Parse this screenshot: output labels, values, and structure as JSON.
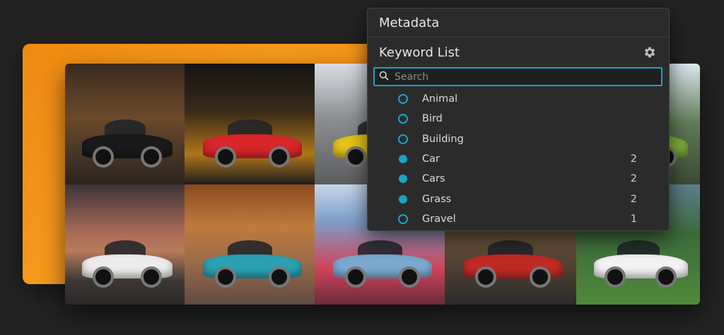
{
  "panel": {
    "title": "Metadata",
    "section_title": "Keyword List",
    "search_placeholder": "Search",
    "accent_color": "#1aa3c6"
  },
  "keywords": [
    {
      "label": "Animal",
      "count": "",
      "checked": false
    },
    {
      "label": "Bird",
      "count": "",
      "checked": false
    },
    {
      "label": "Building",
      "count": "",
      "checked": false
    },
    {
      "label": "Car",
      "count": "2",
      "checked": true
    },
    {
      "label": "Cars",
      "count": "2",
      "checked": true
    },
    {
      "label": "Grass",
      "count": "2",
      "checked": true
    },
    {
      "label": "Gravel",
      "count": "1",
      "checked": false
    }
  ],
  "photos": [
    {
      "name": "black-classic-porsche",
      "bg": "linear-gradient(180deg,#3b2a1e 0%,#6b4a2c 45%,#2a241e 100%)",
      "car": "#1a1a1a"
    },
    {
      "name": "red-porsche-gt3",
      "bg": "linear-gradient(180deg,#151515 0%,#3a2a18 40%,#b0761a 75%,#1b1b1b 100%)",
      "car": "#d8262a"
    },
    {
      "name": "yellow-sports-car",
      "bg": "linear-gradient(180deg,#d9dde3 0%,#8d8f92 45%,#5a5c5e 100%)",
      "car": "#e6c21a"
    },
    {
      "name": "classic-blue-sedan-top",
      "bg": "linear-gradient(180deg,#4d5460 0%,#2a2f36 100%)",
      "car": "#6f8aa8"
    },
    {
      "name": "green-porsche",
      "bg": "linear-gradient(180deg,#dbe6ee 0%,#5d7a54 50%,#3a4a35 100%)",
      "car": "#7bae3c"
    },
    {
      "name": "white-coupe-sunset",
      "bg": "linear-gradient(180deg,#3e3438 0%,#a86a55 40%,#b97b5c 55%,#3d3836 80%,#2a2828 100%)",
      "car": "#ececec"
    },
    {
      "name": "blue-alpine-forest",
      "bg": "linear-gradient(180deg,#8a4a1e 0%,#c07a3c 35%,#9b6a4b 65%,#5f4b42 100%)",
      "car": "#2aa0b0"
    },
    {
      "name": "blue-lincoln-tunnel",
      "bg": "linear-gradient(180deg,#c6d6ea 0%,#7e9fc8 30%,#d0435a 70%,#6a2b3a 100%)",
      "car": "#7aa8cf"
    },
    {
      "name": "red-pontiac",
      "bg": "linear-gradient(180deg,#5a3a1e 0%,#7a5a3a 30%,#2b2b2b 100%)",
      "car": "#c02a24"
    },
    {
      "name": "white-911-mountains",
      "bg": "linear-gradient(180deg,#5f7d8e 0%,#3c6a3a 40%,#4f8a3a 100%)",
      "car": "#f2f2f2"
    }
  ]
}
